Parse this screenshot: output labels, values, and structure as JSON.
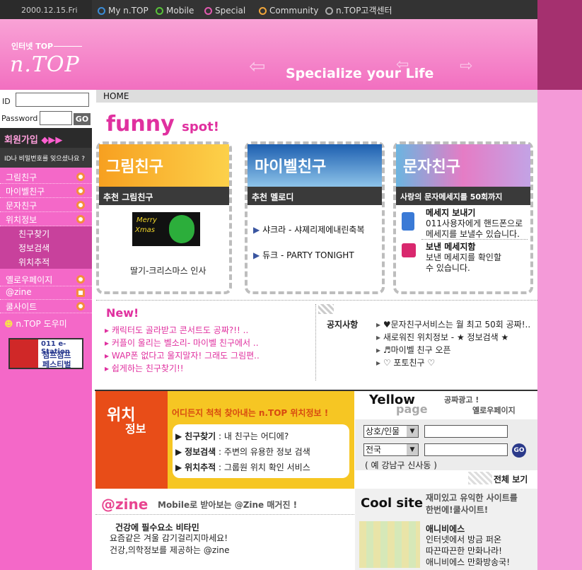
{
  "topbar": {
    "date": "2000.12.15.Fri",
    "nav": [
      {
        "label": "My n.TOP",
        "color": "#3b8cd6"
      },
      {
        "label": "Mobile",
        "color": "#58c23a"
      },
      {
        "label": "Special",
        "color": "#e25ab0"
      },
      {
        "label": "Community",
        "color": "#f0a53a"
      },
      {
        "label": "n.TOP고객센터",
        "color": "#aaaaaa"
      }
    ]
  },
  "header": {
    "logo_small": "인터넷 TOP",
    "logo": "n.TOP",
    "slogan_a": "Specialize",
    "slogan_b": "your Life"
  },
  "login": {
    "id_label": "ID",
    "password_label": "Password",
    "go": "GO",
    "join": "회원가입",
    "forgot": "ID나 비밀번호를 잊으셨나요 ?"
  },
  "menu": [
    {
      "label": "그림친구",
      "icon": "sun-icon"
    },
    {
      "label": "마이벨친구",
      "icon": "bell-icon"
    },
    {
      "label": "문자친구",
      "icon": "letter-icon"
    },
    {
      "label": "위치정보",
      "icon": "target-icon"
    }
  ],
  "submenu": [
    "친구찾기",
    "정보검색",
    "위치추적"
  ],
  "menu2": [
    {
      "label": "옐로우페이지",
      "icon": "phone-icon"
    },
    {
      "label": "@zine",
      "icon": "zine-icon"
    },
    {
      "label": "쿨사이트",
      "icon": "bulb-icon"
    }
  ],
  "help": "n.TOP 도우미",
  "banner": {
    "line1": "011",
    "line2": "e-Station",
    "line3": "점프점프",
    "line4": "페스티벌"
  },
  "breadcrumb": "HOME",
  "funny": {
    "title": "funny",
    "sub": "spot!"
  },
  "cards": [
    {
      "title": "그림친구",
      "sub": "추천 그림친구",
      "image_text_a": "Merry",
      "image_text_b": "Xmas",
      "caption": "딸기-크리스마스 인사"
    },
    {
      "title": "마이벨친구",
      "sub": "추천 멜로디",
      "items": [
        "샤크라 - 샤졔리제에내린축복",
        "듀크 - PARTY TONIGHT"
      ]
    },
    {
      "title": "문자친구",
      "sub": "사랑의 문자메세지를 50회까지",
      "items": [
        {
          "head": "메세지 보내기",
          "body1": "011사용자에게 핸드폰으로",
          "body2": "메세지를 보낼수 있습니다."
        },
        {
          "head": "보낸 메세지함",
          "body1": "보낸 메세지를 확인할",
          "body2": "수 있습니다."
        }
      ]
    }
  ],
  "new_section": {
    "title": "New!",
    "items": [
      "캐릭터도 골라받고 콘서트도 공짜?!! ..",
      "커플이 울리는 벨소리- 마이벨 친구에서 ..",
      "WAP폰 없다고 울지말자! 그래도 그림편..",
      "쉽게하는 친구찾기!!"
    ]
  },
  "notice": {
    "title": "공지사항",
    "items": [
      "♥문자친구서비스는 월 최고 50회 공짜!..",
      "새로워진 위치정보 - ★ 정보검색 ★",
      "♬마이벨 친구 오픈",
      "♡ 포토친구 ♡"
    ]
  },
  "location": {
    "side_a": "위치",
    "side_b": "정보",
    "headline": "어디든지 척척 찾아내는 n.TOP 위치정보 !",
    "rows": [
      {
        "key": "친구찾기",
        "val": "내 친구는 어디에?"
      },
      {
        "key": "정보검색",
        "val": "주변의 유용한 정보 검색"
      },
      {
        "key": "위치추적",
        "val": "그룹원 위치 확인 서비스"
      }
    ]
  },
  "yellow": {
    "logo_a": "Yellow",
    "logo_b": "page",
    "tag1": "공짜광고 !",
    "tag2": "옐로우페이지",
    "select1": "상호/인물",
    "select2": "전국",
    "go": "GO",
    "example": "( 예 강남구 신사동 )",
    "all": "전체 보기"
  },
  "zine": {
    "logo": "@zine",
    "tagline": "Mobile로 받아보는 @Zine 매거진 !",
    "head": "건강에 필수요소 비타민",
    "line1": "요즘같은 겨울 감기걸리지마세요!",
    "line2": "건강,의학정보를 제공하는 @zine"
  },
  "cool": {
    "logo": "Cool site",
    "tag1": "재미있고 유익한 사이트를",
    "tag2": "한번에!쿨사이트!",
    "head": "애니비에스",
    "line1": "인터넷에서 방금 퍼온",
    "line2": "따끈따끈한 만화나라!",
    "line3": "애니비에스 만화방송국!"
  }
}
